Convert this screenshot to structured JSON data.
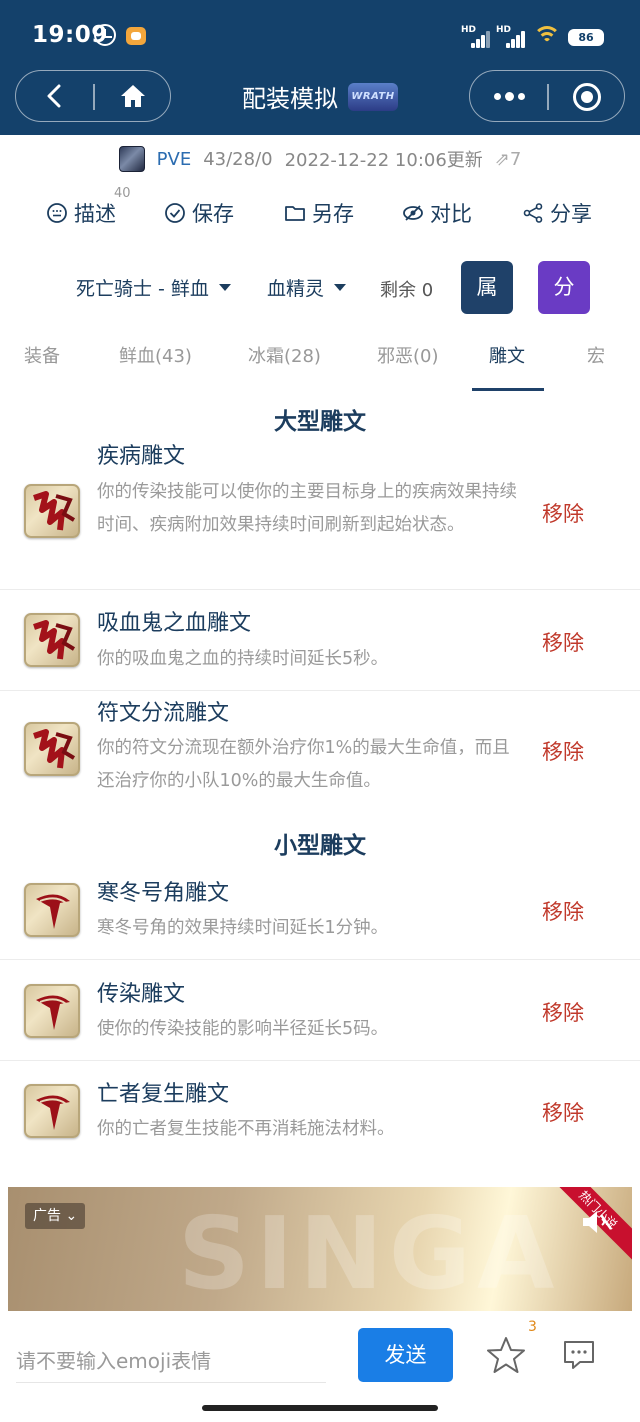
{
  "status_bar": {
    "time": "19:09",
    "battery": "86",
    "hd": "HD"
  },
  "nav": {
    "title": "配装模拟",
    "badge": "WRATH"
  },
  "meta": {
    "mode": "PVE",
    "points": "43/28/0",
    "updated": "2022-12-22 10:06更新",
    "shares": "7"
  },
  "actions": {
    "describe": "描述",
    "describe_count": "40",
    "save": "保存",
    "save_as": "另存",
    "compare": "对比",
    "share": "分享"
  },
  "selectors": {
    "class_spec": "死亡骑士 - 鲜血",
    "build": "血精灵",
    "remaining": "剩余 0",
    "attr_btn": "属",
    "points_btn": "分"
  },
  "tabs": [
    {
      "label": "装备"
    },
    {
      "label": "鲜血(43)"
    },
    {
      "label": "冰霜(28)"
    },
    {
      "label": "邪恶(0)"
    },
    {
      "label": "雕文"
    },
    {
      "label": "宏"
    }
  ],
  "major": {
    "title": "大型雕文",
    "items": [
      {
        "name": "疾病雕文",
        "desc": "你的传染技能可以使你的主要目标身上的疾病效果持续时间、疾病附加效果持续时间刷新到起始状态。",
        "action": "移除"
      },
      {
        "name": "吸血鬼之血雕文",
        "desc": "你的吸血鬼之血的持续时间延长5秒。",
        "action": "移除"
      },
      {
        "name": "符文分流雕文",
        "desc": "你的符文分流现在额外治疗你1%的最大生命值，而且还治疗你的小队10%的最大生命值。",
        "action": "移除"
      }
    ]
  },
  "minor": {
    "title": "小型雕文",
    "items": [
      {
        "name": "寒冬号角雕文",
        "desc": "寒冬号角的效果持续时间延长1分钟。",
        "action": "移除"
      },
      {
        "name": "传染雕文",
        "desc": "使你的传染技能的影响半径延长5码。",
        "action": "移除"
      },
      {
        "name": "亡者复生雕文",
        "desc": "你的亡者复生技能不再消耗施法材料。",
        "action": "移除"
      }
    ]
  },
  "ad": {
    "tag": "广告",
    "hot": "热门小说",
    "bg_text": "SINGA"
  },
  "bottom": {
    "placeholder": "请不要输入emoji表情",
    "send": "发送",
    "star_count": "3"
  },
  "colors": {
    "navy": "#14416b",
    "accent_blue": "#1a7ee6",
    "remove_red": "#c0392b",
    "purple": "#6a3bc4"
  }
}
